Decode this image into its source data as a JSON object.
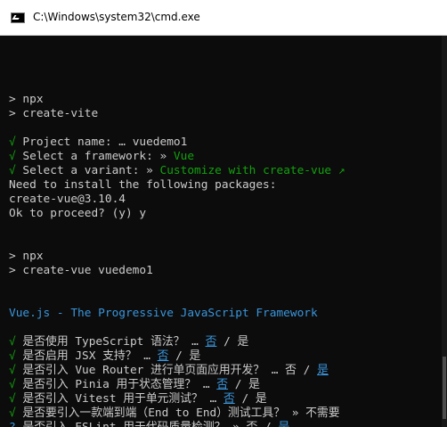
{
  "window": {
    "title": "C:\\Windows\\system32\\cmd.exe"
  },
  "colors": {
    "background": "#0c0c0c",
    "text": "#cccccc",
    "green": "#13a10e",
    "cyan": "#3a96dd",
    "titlebar": "#ffffff"
  },
  "terminal": {
    "lines": [
      {
        "segments": []
      },
      {
        "segments": []
      },
      {
        "segments": [
          {
            "text": "> npx"
          }
        ]
      },
      {
        "segments": [
          {
            "text": "> create-vite"
          }
        ]
      },
      {
        "segments": []
      },
      {
        "segments": [
          {
            "text": "√",
            "color": "green"
          },
          {
            "text": " Project name: … vuedemo1"
          }
        ]
      },
      {
        "segments": [
          {
            "text": "√",
            "color": "green"
          },
          {
            "text": " Select a framework: » "
          },
          {
            "text": "Vue",
            "color": "green"
          }
        ]
      },
      {
        "segments": [
          {
            "text": "√",
            "color": "green"
          },
          {
            "text": " Select a variant: » "
          },
          {
            "text": "Customize with create-vue ↗",
            "color": "green"
          }
        ]
      },
      {
        "segments": [
          {
            "text": "Need to install the following packages:"
          }
        ]
      },
      {
        "segments": [
          {
            "text": "create-vue@3.10.4"
          }
        ]
      },
      {
        "segments": [
          {
            "text": "Ok to proceed? (y) y"
          }
        ]
      },
      {
        "segments": []
      },
      {
        "segments": []
      },
      {
        "segments": [
          {
            "text": "> npx"
          }
        ]
      },
      {
        "segments": [
          {
            "text": "> create-vue vuedemo1"
          }
        ]
      },
      {
        "segments": []
      },
      {
        "segments": []
      },
      {
        "segments": [
          {
            "text": "Vue.js - The Progressive JavaScript Framework",
            "color": "cyan"
          }
        ]
      },
      {
        "segments": []
      },
      {
        "segments": [
          {
            "text": "√",
            "color": "green"
          },
          {
            "text": " 是否使用 TypeScript 语法？ … "
          },
          {
            "text": "否",
            "color": "cyan",
            "underline": true
          },
          {
            "text": " / 是"
          }
        ]
      },
      {
        "segments": [
          {
            "text": "√",
            "color": "green"
          },
          {
            "text": " 是否启用 JSX 支持？ … "
          },
          {
            "text": "否",
            "color": "cyan",
            "underline": true
          },
          {
            "text": " / 是"
          }
        ]
      },
      {
        "segments": [
          {
            "text": "√",
            "color": "green"
          },
          {
            "text": " 是否引入 Vue Router 进行单页面应用开发？ … 否 / "
          },
          {
            "text": "是",
            "color": "cyan",
            "underline": true
          }
        ]
      },
      {
        "segments": [
          {
            "text": "√",
            "color": "green"
          },
          {
            "text": " 是否引入 Pinia 用于状态管理？ … "
          },
          {
            "text": "否",
            "color": "cyan",
            "underline": true
          },
          {
            "text": " / 是"
          }
        ]
      },
      {
        "segments": [
          {
            "text": "√",
            "color": "green"
          },
          {
            "text": " 是否引入 Vitest 用于单元测试？ … "
          },
          {
            "text": "否",
            "color": "cyan",
            "underline": true
          },
          {
            "text": " / 是"
          }
        ]
      },
      {
        "segments": [
          {
            "text": "√",
            "color": "green"
          },
          {
            "text": " 是否要引入一款端到端（End to End）测试工具？ » 不需要"
          }
        ]
      },
      {
        "segments": [
          {
            "text": "?",
            "color": "cyan"
          },
          {
            "text": " 是否引入 ESLint 用于代码质量检测？ » 否 / "
          },
          {
            "text": "是",
            "color": "cyan",
            "underline": true
          }
        ]
      }
    ]
  }
}
